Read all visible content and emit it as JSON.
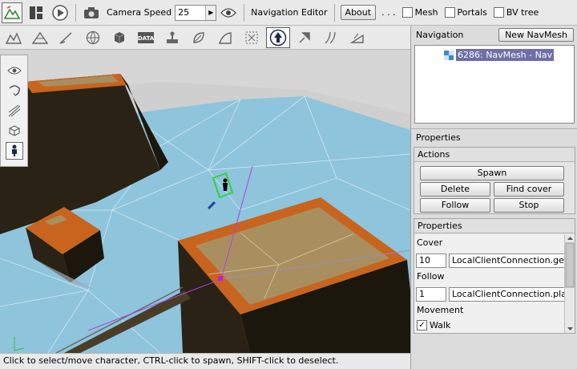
{
  "toolbar": {
    "camera_speed_label": "Camera Speed",
    "camera_speed_value": "25",
    "mode_label": "Navigation Editor",
    "about_label": "About",
    "ellipsis": ". . .",
    "mesh_label": "Mesh",
    "portals_label": "Portals",
    "bv_tree_label": "BV tree",
    "mesh_checked": false,
    "portals_checked": false,
    "bv_tree_checked": false
  },
  "tools": [
    "terrain-icon",
    "mountain-icon",
    "brush-icon",
    "globe-icon",
    "cube-icon",
    "data-icon",
    "joystick-icon",
    "leaf-icon",
    "stairs-icon",
    "select-region-icon",
    "navigation-icon",
    "arrow-walk-icon",
    "rails-icon",
    "ramp-icon"
  ],
  "data_tool_text": "DATA",
  "left_tools": [
    "eye-icon",
    "rotate-icon",
    "path-icon",
    "box-outline-icon",
    "character-icon"
  ],
  "navigation": {
    "title": "Navigation",
    "new_button": "New NavMesh",
    "items": [
      {
        "label": "6286: NavMesh - Nav"
      }
    ]
  },
  "properties_title": "Properties",
  "actions": {
    "title": "Actions",
    "spawn": "Spawn",
    "delete": "Delete",
    "find_cover": "Find cover",
    "follow": "Follow",
    "stop": "Stop"
  },
  "properties": {
    "title": "Properties",
    "cover_label": "Cover",
    "cover_value": "10",
    "cover_expr": "LocalClientConnection.getCo",
    "follow_label": "Follow",
    "follow_value": "1",
    "follow_expr": "LocalClientConnection.player",
    "movement_label": "Movement",
    "walk_label": "Walk",
    "walk_checked": true
  },
  "status": "Click to select/move character, CTRL-click to spawn, SHIFT-click to deselect.",
  "colors": {
    "nav_mesh": "#8ec4dc",
    "orange_edge": "#c8641e",
    "object_dark": "#2a2214",
    "selection": "#6e6ea8",
    "path": "#b040e0"
  }
}
